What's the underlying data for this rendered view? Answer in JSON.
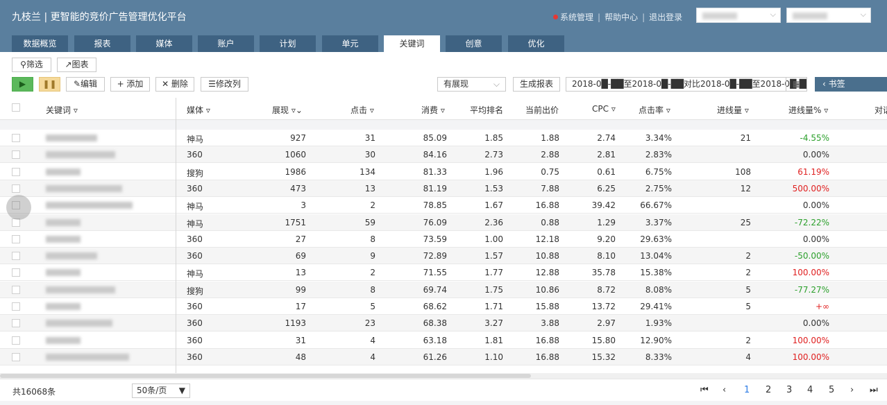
{
  "header": {
    "brand": "九枝兰 | 更智能的竞价广告管理优化平台",
    "links": [
      "系统管理",
      "帮助中心",
      "退出登录"
    ]
  },
  "tabs": [
    {
      "label": "数据概览"
    },
    {
      "label": "报表"
    },
    {
      "label": "媒体"
    },
    {
      "label": "账户"
    },
    {
      "label": "计划"
    },
    {
      "label": "单元"
    },
    {
      "label": "关键词"
    },
    {
      "label": "创意"
    },
    {
      "label": "优化"
    }
  ],
  "active_tab": "关键词",
  "toolbar": {
    "filter": "筛选",
    "chart": "图表",
    "edit": "编辑",
    "add": "+ 添加",
    "delete": "✕ 删除",
    "modify_columns": "修改列",
    "display_select": "有展现",
    "generate_report": "生成报表",
    "date_range": "2018-0█-██至2018-0█-██对比2018-0█-██至2018-0█-██",
    "bookmark": "‹ 书签"
  },
  "columns": [
    "关键词",
    "媒体",
    "展现",
    "点击",
    "消费",
    "平均排名",
    "当前出价",
    "CPC",
    "点击率",
    "进线量",
    "进线量%",
    "对话"
  ],
  "rows": [
    {
      "media": "神马",
      "impressions": "927",
      "clicks": "31",
      "cost": "85.09",
      "rank": "1.85",
      "bid": "1.88",
      "cpc": "2.74",
      "ctr": "3.34%",
      "leads": "21",
      "leads_pct": "-4.55%",
      "pct_color": "#2ca02c"
    },
    {
      "media": "360",
      "impressions": "1060",
      "clicks": "30",
      "cost": "84.16",
      "rank": "2.73",
      "bid": "2.88",
      "cpc": "2.81",
      "ctr": "2.83%",
      "leads": "",
      "leads_pct": "0.00%",
      "pct_color": "#333333"
    },
    {
      "media": "搜狗",
      "impressions": "1986",
      "clicks": "134",
      "cost": "81.33",
      "rank": "1.96",
      "bid": "0.75",
      "cpc": "0.61",
      "ctr": "6.75%",
      "leads": "108",
      "leads_pct": "61.19%",
      "pct_color": "#e02020"
    },
    {
      "media": "360",
      "impressions": "473",
      "clicks": "13",
      "cost": "81.19",
      "rank": "1.53",
      "bid": "7.88",
      "cpc": "6.25",
      "ctr": "2.75%",
      "leads": "12",
      "leads_pct": "500.00%",
      "pct_color": "#e02020"
    },
    {
      "media": "神马",
      "impressions": "3",
      "clicks": "2",
      "cost": "78.85",
      "rank": "1.67",
      "bid": "16.88",
      "cpc": "39.42",
      "ctr": "66.67%",
      "leads": "",
      "leads_pct": "0.00%",
      "pct_color": "#333333"
    },
    {
      "media": "神马",
      "impressions": "1751",
      "clicks": "59",
      "cost": "76.09",
      "rank": "2.36",
      "bid": "0.88",
      "cpc": "1.29",
      "ctr": "3.37%",
      "leads": "25",
      "leads_pct": "-72.22%",
      "pct_color": "#2ca02c"
    },
    {
      "media": "360",
      "impressions": "27",
      "clicks": "8",
      "cost": "73.59",
      "rank": "1.00",
      "bid": "12.18",
      "cpc": "9.20",
      "ctr": "29.63%",
      "leads": "",
      "leads_pct": "0.00%",
      "pct_color": "#333333"
    },
    {
      "media": "360",
      "impressions": "69",
      "clicks": "9",
      "cost": "72.89",
      "rank": "1.57",
      "bid": "10.88",
      "cpc": "8.10",
      "ctr": "13.04%",
      "leads": "2",
      "leads_pct": "-50.00%",
      "pct_color": "#2ca02c"
    },
    {
      "media": "神马",
      "impressions": "13",
      "clicks": "2",
      "cost": "71.55",
      "rank": "1.77",
      "bid": "12.88",
      "cpc": "35.78",
      "ctr": "15.38%",
      "leads": "2",
      "leads_pct": "100.00%",
      "pct_color": "#e02020"
    },
    {
      "media": "搜狗",
      "impressions": "99",
      "clicks": "8",
      "cost": "69.74",
      "rank": "1.75",
      "bid": "10.86",
      "cpc": "8.72",
      "ctr": "8.08%",
      "leads": "5",
      "leads_pct": "-77.27%",
      "pct_color": "#2ca02c"
    },
    {
      "media": "360",
      "impressions": "17",
      "clicks": "5",
      "cost": "68.62",
      "rank": "1.71",
      "bid": "15.88",
      "cpc": "13.72",
      "ctr": "29.41%",
      "leads": "5",
      "leads_pct": "+∞",
      "pct_color": "#e02020"
    },
    {
      "media": "360",
      "impressions": "1193",
      "clicks": "23",
      "cost": "68.38",
      "rank": "3.27",
      "bid": "3.88",
      "cpc": "2.97",
      "ctr": "1.93%",
      "leads": "",
      "leads_pct": "0.00%",
      "pct_color": "#333333"
    },
    {
      "media": "360",
      "impressions": "31",
      "clicks": "4",
      "cost": "63.18",
      "rank": "1.81",
      "bid": "16.88",
      "cpc": "15.80",
      "ctr": "12.90%",
      "leads": "2",
      "leads_pct": "100.00%",
      "pct_color": "#e02020"
    },
    {
      "media": "360",
      "impressions": "48",
      "clicks": "4",
      "cost": "61.26",
      "rank": "1.10",
      "bid": "16.88",
      "cpc": "15.32",
      "ctr": "8.33%",
      "leads": "4",
      "leads_pct": "100.00%",
      "pct_color": "#e02020"
    }
  ],
  "footer": {
    "total": "共16068条",
    "page_size": "50条/页",
    "pages": [
      "1",
      "2",
      "3",
      "4",
      "5"
    ],
    "current_page": "1"
  }
}
